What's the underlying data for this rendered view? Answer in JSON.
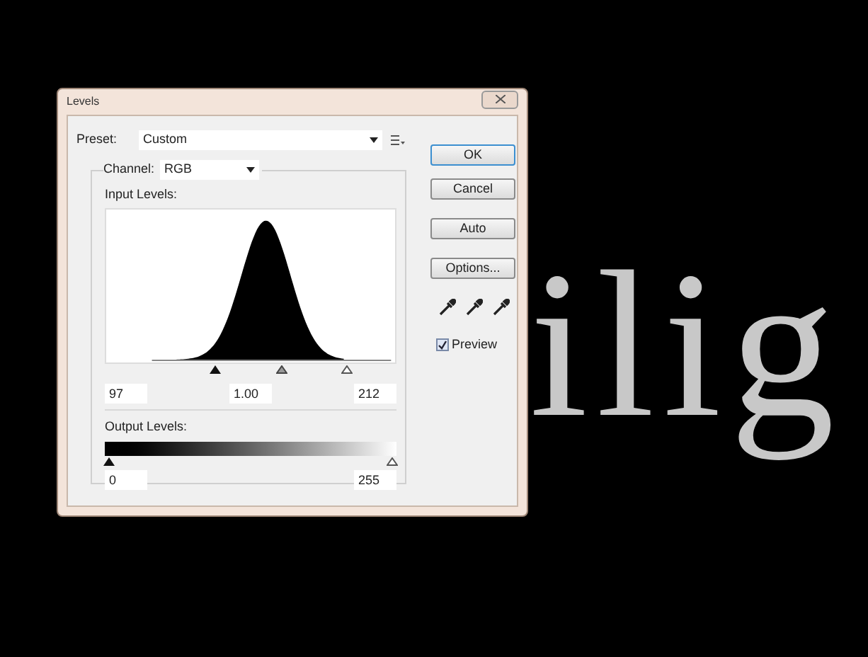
{
  "dialog": {
    "title": "Levels",
    "preset": {
      "label": "Preset:",
      "value": "Custom"
    },
    "channel": {
      "label": "Channel:",
      "value": "RGB"
    },
    "input_levels": {
      "label": "Input Levels:",
      "black_point": "97",
      "gamma": "1.00",
      "white_point": "212"
    },
    "output_levels": {
      "label": "Output Levels:",
      "black": "0",
      "white": "255"
    },
    "buttons": [
      "OK",
      "Cancel",
      "Auto",
      "Options..."
    ],
    "preview": {
      "label": "Preview",
      "checked": true
    }
  },
  "canvas": {
    "text": "ilig"
  }
}
